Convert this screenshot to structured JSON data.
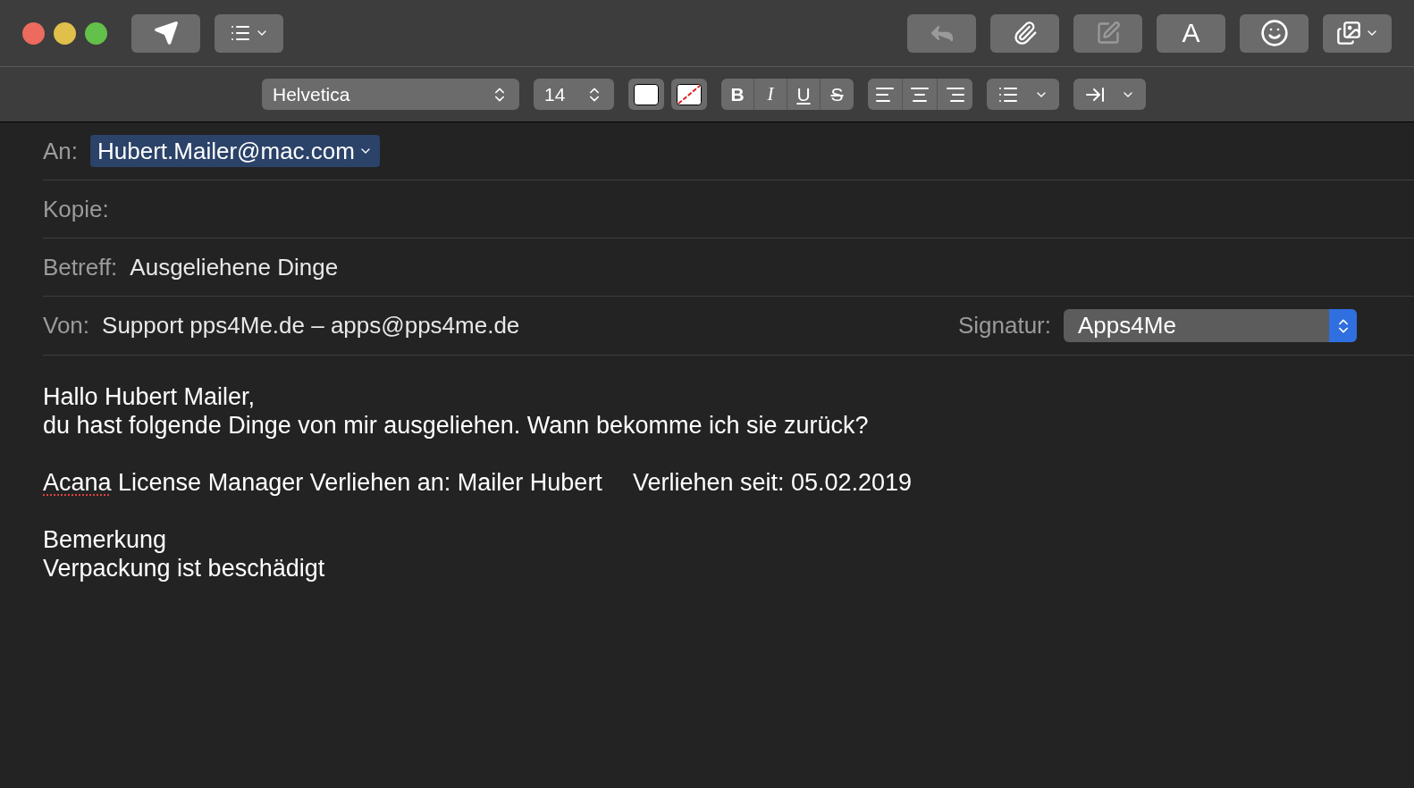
{
  "toolbar": {
    "left_buttons": [
      {
        "kind": "send",
        "disabled": false
      },
      {
        "kind": "header-fields",
        "disabled": false
      }
    ],
    "right_buttons": [
      {
        "kind": "reply",
        "disabled": true
      },
      {
        "kind": "attach",
        "disabled": false
      },
      {
        "kind": "markup",
        "disabled": true
      },
      {
        "kind": "fonts",
        "label": "A",
        "disabled": false
      },
      {
        "kind": "emoji",
        "disabled": false
      },
      {
        "kind": "photos",
        "disabled": false
      }
    ]
  },
  "format_bar": {
    "font": "Helvetica",
    "size": "14",
    "style_buttons": [
      {
        "label": "B",
        "kind": "bold"
      },
      {
        "label": "I",
        "kind": "italic"
      },
      {
        "label": "U",
        "kind": "underline"
      },
      {
        "label": "S",
        "kind": "strike"
      }
    ]
  },
  "header": {
    "to_label": "An:",
    "to": "Hubert.Mailer@mac.com",
    "cc_label": "Kopie:",
    "subject_label": "Betreff:",
    "subject": "Ausgeliehene Dinge",
    "from_label": "Von:",
    "from": "Support pps4Me.de – apps@pps4me.de",
    "signature_label": "Signatur:",
    "signature": "Apps4Me"
  },
  "body": [
    {
      "kind": "line",
      "text": "Hallo Hubert Mailer,"
    },
    {
      "kind": "line",
      "text": "du hast folgende Dinge von mir ausgeliehen. Wann bekomme ich sie zurück?"
    },
    {
      "kind": "blank"
    },
    {
      "kind": "item",
      "parts": [
        {
          "text": "Acana",
          "misspelled": true
        },
        {
          "text": " License Manager Verliehen an: Mailer Hubert",
          "misspelled": false
        }
      ],
      "since": "Verliehen seit: 05.02.2019"
    },
    {
      "kind": "blank"
    },
    {
      "kind": "line",
      "text": "Bemerkung"
    },
    {
      "kind": "line",
      "text": "Verpackung ist beschädigt"
    }
  ]
}
